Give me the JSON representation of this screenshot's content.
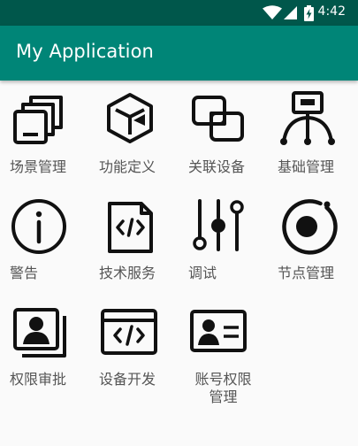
{
  "status_bar": {
    "time": "4:42",
    "icons": [
      "wifi-icon",
      "signal-icon",
      "battery-charging-icon"
    ]
  },
  "app_bar": {
    "title": "My Application"
  },
  "grid": {
    "items": [
      {
        "label": "场景管理",
        "icon": "scene-manage-icon"
      },
      {
        "label": "功能定义",
        "icon": "cube-icon"
      },
      {
        "label": "关联设备",
        "icon": "linked-devices-icon"
      },
      {
        "label": "基础管理",
        "icon": "network-node-icon"
      },
      {
        "label": "警告",
        "icon": "info-alert-icon"
      },
      {
        "label": "技术服务",
        "icon": "code-file-icon"
      },
      {
        "label": "调试",
        "icon": "sliders-icon"
      },
      {
        "label": "节点管理",
        "icon": "node-ring-icon"
      },
      {
        "label": "权限审批",
        "icon": "user-cards-icon"
      },
      {
        "label": "设备开发",
        "icon": "code-window-icon"
      },
      {
        "label": "账号权限管理",
        "label_line1": "账号权限",
        "label_line2": "管理",
        "icon": "id-card-icon"
      }
    ]
  }
}
